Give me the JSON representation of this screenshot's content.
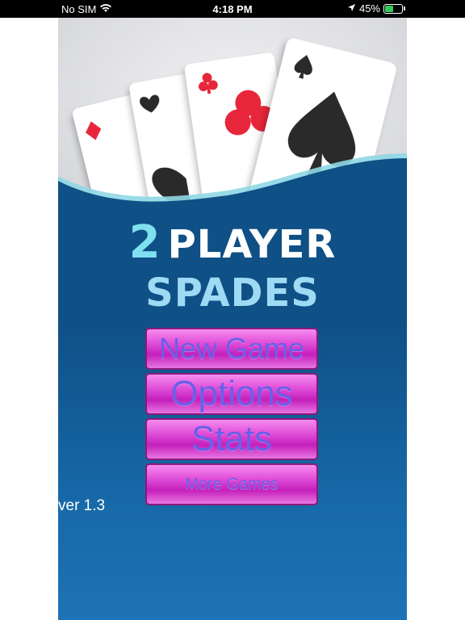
{
  "status_bar": {
    "carrier": "No SIM",
    "time": "4:18 PM",
    "battery": "45%"
  },
  "title": {
    "number": "2",
    "line1": "PLAYER",
    "line2": "SPADES"
  },
  "menu": {
    "new_game": "New Game",
    "options": "Options",
    "stats": "Stats",
    "more_games": "More Games"
  },
  "version": "ver 1.3",
  "colors": {
    "background": "#0f5087",
    "button": "#d438cb",
    "button_text": "#6a5fe8",
    "title_white": "#ffffff",
    "title_cyan": "#7fe0ef"
  }
}
